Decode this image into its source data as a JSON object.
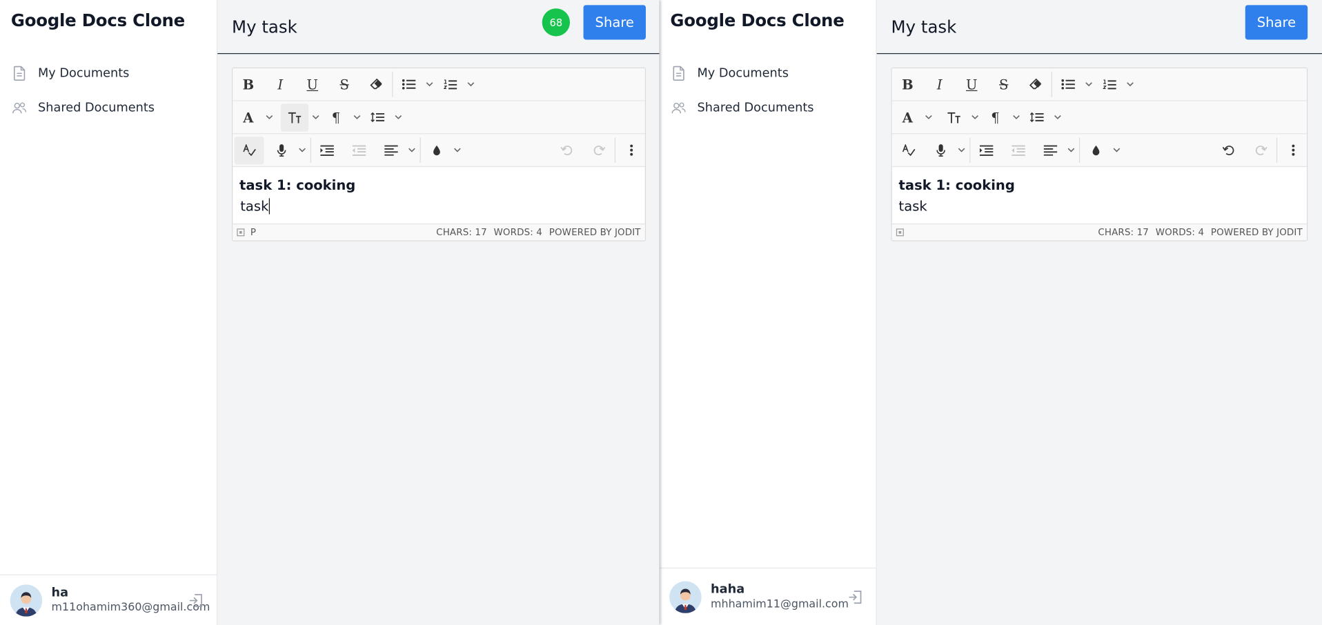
{
  "windows": [
    {
      "app": {
        "title": "Google Docs Clone"
      },
      "sidebar": {
        "items": [
          {
            "label": "My Documents",
            "icon": "document-icon"
          },
          {
            "label": "Shared Documents",
            "icon": "users-icon"
          }
        ]
      },
      "user": {
        "name": "ha",
        "email": "m11ohamim360@gmail.com"
      },
      "document": {
        "title": "My task",
        "badge": "68",
        "share_label": "Share"
      },
      "editor": {
        "heading": "task 1: cooking",
        "body": "task",
        "status": {
          "path": "P",
          "chars": "CHARS: 17",
          "words": "WORDS: 4",
          "powered": "POWERED BY JODIT"
        }
      }
    },
    {
      "app": {
        "title": "Google Docs Clone"
      },
      "sidebar": {
        "items": [
          {
            "label": "My Documents",
            "icon": "document-icon"
          },
          {
            "label": "Shared Documents",
            "icon": "users-icon"
          }
        ]
      },
      "user": {
        "name": "haha",
        "email": "mhhamim11@gmail.com"
      },
      "document": {
        "title": "My task",
        "share_label": "Share"
      },
      "editor": {
        "heading": "task 1: cooking",
        "body": "task",
        "status": {
          "chars": "CHARS: 17",
          "words": "WORDS: 4",
          "powered": "POWERED BY JODIT"
        }
      }
    }
  ],
  "colors": {
    "accent": "#2f80ed",
    "badge": "#16c44d",
    "background": "#f3f4f6"
  }
}
